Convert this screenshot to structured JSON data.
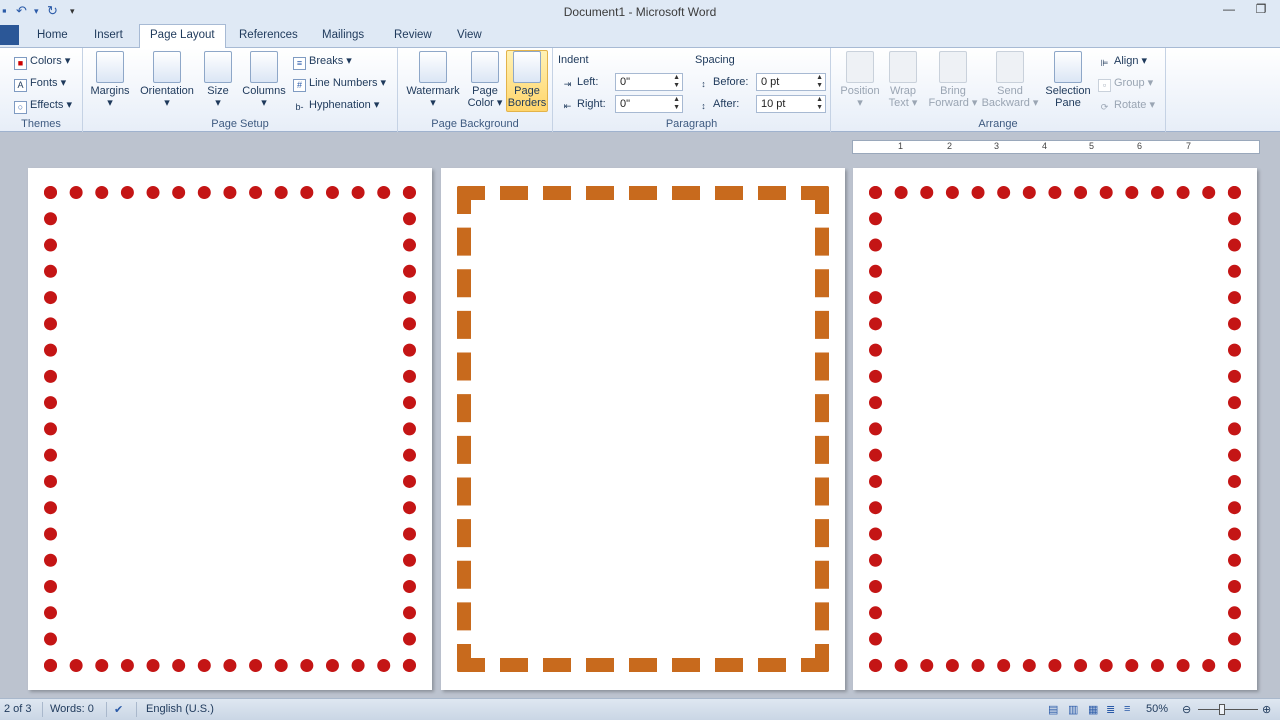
{
  "window": {
    "title": "Document1  -  Microsoft Word"
  },
  "qat": {
    "save": "▪",
    "undo": "↶",
    "redo": "↻",
    "more": "▾"
  },
  "tabs": [
    {
      "label": "Home"
    },
    {
      "label": "Insert"
    },
    {
      "label": "Page Layout"
    },
    {
      "label": "References"
    },
    {
      "label": "Mailings"
    },
    {
      "label": "Review"
    },
    {
      "label": "View"
    }
  ],
  "ribbon": {
    "themes": {
      "label": "Themes",
      "colors": "Colors ▾",
      "fonts": "Fonts ▾",
      "effects": "Effects ▾"
    },
    "page_setup": {
      "label": "Page Setup",
      "margins": "Margins",
      "orientation": "Orientation",
      "size": "Size",
      "columns": "Columns",
      "breaks": "Breaks ▾",
      "line_numbers": "Line Numbers ▾",
      "hyphenation": "Hyphenation ▾"
    },
    "page_background": {
      "label": "Page Background",
      "watermark": "Watermark",
      "page_color_1": "Page",
      "page_color_2": "Color ▾",
      "page_borders_1": "Page",
      "page_borders_2": "Borders"
    },
    "paragraph": {
      "label": "Paragraph",
      "indent": "Indent",
      "spacing": "Spacing",
      "left_label": "Left:",
      "left_value": "0\"",
      "right_label": "Right:",
      "right_value": "0\"",
      "before_label": "Before:",
      "before_value": "0 pt",
      "after_label": "After:",
      "after_value": "10 pt"
    },
    "arrange": {
      "label": "Arrange",
      "position": "Position",
      "wrap_1": "Wrap",
      "wrap_2": "Text ▾",
      "bring_1": "Bring",
      "bring_2": "Forward ▾",
      "send_1": "Send",
      "send_2": "Backward ▾",
      "selection_1": "Selection",
      "selection_2": "Pane",
      "align": "Align ▾",
      "group": "Group ▾",
      "rotate": "Rotate ▾"
    }
  },
  "ruler": [
    "1",
    "2",
    "3",
    "4",
    "5",
    "6",
    "7"
  ],
  "status": {
    "page": "2 of 3",
    "words": "Words: 0",
    "language": "English (U.S.)",
    "zoom": "50%"
  }
}
